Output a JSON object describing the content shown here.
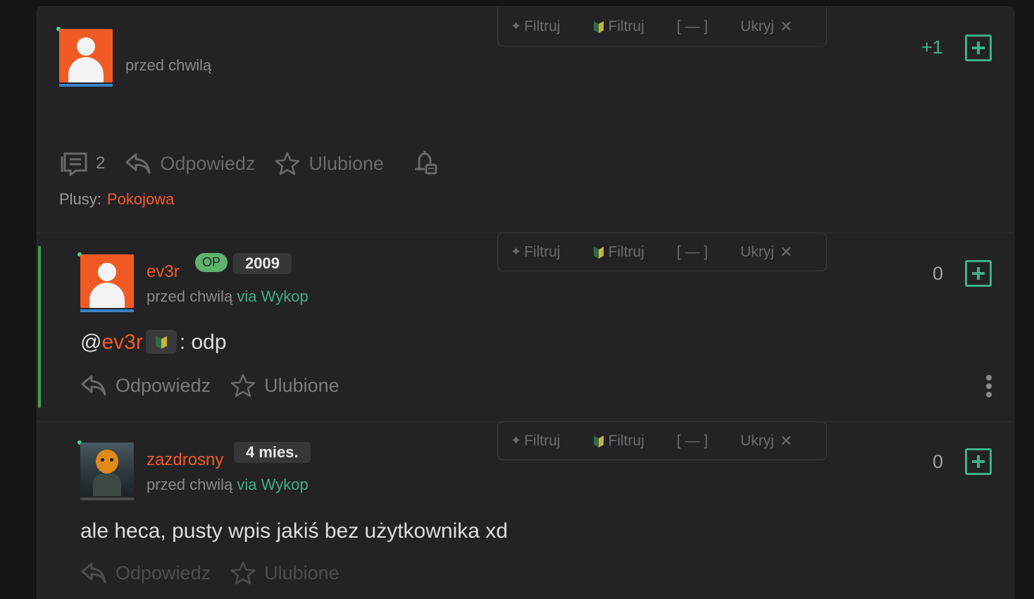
{
  "tabs": {
    "filter1": "Filtruj",
    "filter2": "Filtruj",
    "collapse": "[ — ]",
    "hide": "Ukryj"
  },
  "entry1": {
    "time": "przed chwilą",
    "score": "+1",
    "comment_count": "2",
    "reply": "Odpowiedz",
    "favorite": "Ulubione",
    "plusy_label": "Plusy:",
    "plusy_user": "Pokojowa"
  },
  "entry2": {
    "username": "ev3r",
    "badge_op": "OP",
    "badge_year": "2009",
    "time": "przed chwilą",
    "via": "via Wykop",
    "mention": "@ev3r",
    "text": ": odp",
    "score": "0",
    "reply": "Odpowiedz",
    "favorite": "Ulubione"
  },
  "entry3": {
    "username": "zazdrosny",
    "badge_age": "4 mies.",
    "time": "przed chwilą",
    "via": "via Wykop",
    "text": "ale heca, pusty wpis jakiś bez użytkownika xd",
    "score": "0",
    "reply": "Odpowiedz",
    "favorite": "Ulubione"
  },
  "colors": {
    "accent_orange": "#f15a24",
    "accent_green": "#3fae8a",
    "background": "#232325"
  }
}
